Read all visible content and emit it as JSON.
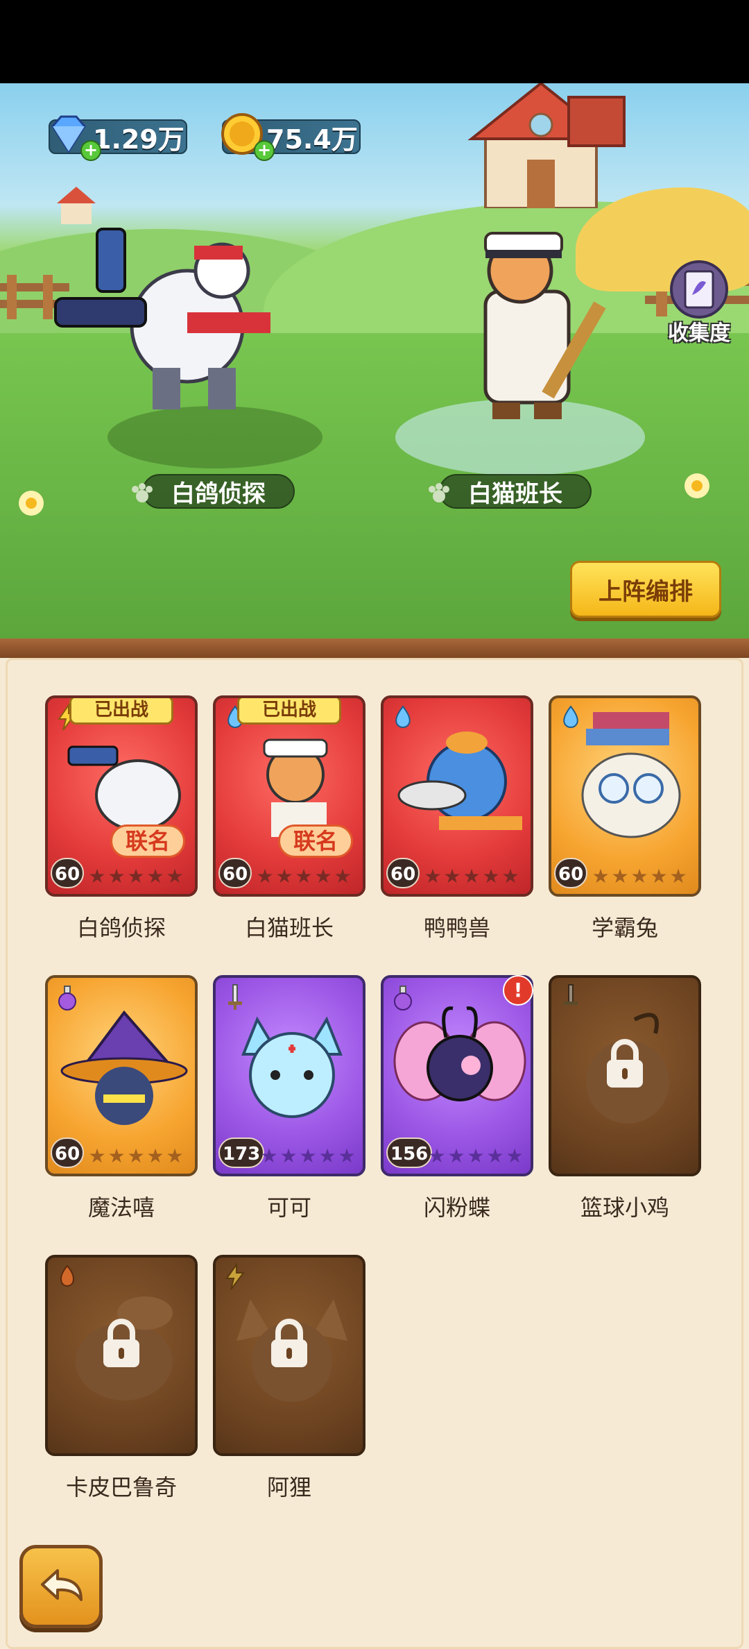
{
  "resources": {
    "diamonds": {
      "icon": "diamond-icon",
      "value": "1.29万"
    },
    "coins": {
      "icon": "coin-icon",
      "value": "75.4万"
    }
  },
  "collection": {
    "icon": "book-icon",
    "label": "收集度"
  },
  "deployed_heroes": [
    {
      "name": "白鸽侦探"
    },
    {
      "name": "白猫班长"
    }
  ],
  "lineup_button": {
    "label": "上阵编排"
  },
  "cards": [
    {
      "name": "白鸽侦探",
      "level": "60",
      "element": "lightning-icon",
      "style": "red",
      "deployed": "已出战",
      "collab": "联名",
      "locked": false
    },
    {
      "name": "白猫班长",
      "level": "60",
      "element": "water-icon",
      "style": "red",
      "deployed": "已出战",
      "collab": "联名",
      "locked": false
    },
    {
      "name": "鸭鸭兽",
      "level": "60",
      "element": "water-icon",
      "style": "red",
      "locked": false
    },
    {
      "name": "学霸兔",
      "level": "60",
      "element": "water-icon",
      "style": "orange",
      "locked": false
    },
    {
      "name": "魔法嘻",
      "level": "60",
      "element": "potion-icon",
      "style": "orange",
      "locked": false
    },
    {
      "name": "可可",
      "level": "173",
      "element": "sword-icon",
      "style": "purple",
      "locked": false
    },
    {
      "name": "闪粉蝶",
      "level": "156",
      "element": "potion-icon",
      "style": "purple",
      "alert": "!",
      "locked": false
    },
    {
      "name": "篮球小鸡",
      "element": "sword-icon",
      "style": "locked",
      "locked": true
    },
    {
      "name": "卡皮巴鲁奇",
      "element": "fire-icon",
      "style": "locked",
      "locked": true
    },
    {
      "name": "阿狸",
      "element": "lightning-icon",
      "style": "locked",
      "locked": true
    }
  ],
  "back_button": {
    "icon": "back-arrow-icon"
  },
  "colors": {
    "accent_yellow": "#f5b719",
    "card_red": "#e33a3a",
    "card_orange": "#f7a531",
    "card_purple": "#9a55e4",
    "locked_brown": "#6b4220"
  }
}
